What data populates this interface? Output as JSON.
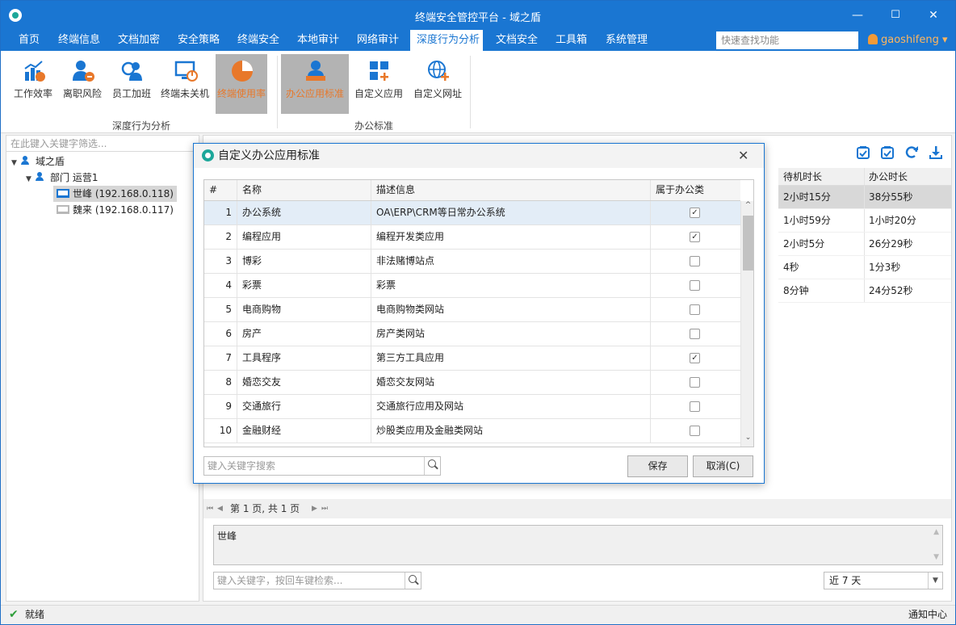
{
  "window": {
    "title": "终端安全管控平台 - 域之盾",
    "min": "—",
    "max": "☐",
    "close": "✕"
  },
  "menu": {
    "items": [
      {
        "label": "首页"
      },
      {
        "label": "终端信息"
      },
      {
        "label": "文档加密"
      },
      {
        "label": "安全策略"
      },
      {
        "label": "终端安全"
      },
      {
        "label": "本地审计"
      },
      {
        "label": "网络审计"
      },
      {
        "label": "深度行为分析",
        "active": true
      },
      {
        "label": "文档安全"
      },
      {
        "label": "工具箱"
      },
      {
        "label": "系统管理"
      }
    ],
    "search_placeholder": "快速查找功能",
    "user": "gaoshifeng",
    "user_caret": "▾"
  },
  "ribbon": {
    "groups": [
      {
        "label": "深度行为分析",
        "buttons": [
          "工作效率",
          "离职风险",
          "员工加班",
          "终端未关机",
          "终端使用率"
        ]
      },
      {
        "label": "办公标准",
        "buttons": [
          "办公应用标准",
          "自定义应用",
          "自定义网址"
        ]
      }
    ],
    "selected": [
      "终端使用率",
      "办公应用标准"
    ]
  },
  "tree": {
    "filter_placeholder": "在此键入关键字筛选...",
    "root": "域之盾",
    "dept": "部门 运营1",
    "terminals": [
      {
        "label": "世峰 (192.168.0.118)",
        "online": true,
        "selected": true
      },
      {
        "label": "魏来 (192.168.0.117)",
        "online": false,
        "selected": false
      }
    ]
  },
  "background_grid": {
    "columns": [
      "待机时长",
      "办公时长"
    ],
    "rows": [
      [
        "2小时15分",
        "38分55秒"
      ],
      [
        "1小时59分",
        "1小时20分"
      ],
      [
        "2小时5分",
        "26分29秒"
      ],
      [
        "4秒",
        "1分3秒"
      ],
      [
        "8分钟",
        "24分52秒"
      ]
    ]
  },
  "pager": {
    "text": "第 1 页, 共 1 页"
  },
  "detail": {
    "text": "世峰"
  },
  "bottom_search_placeholder": "键入关键字，按回车键检索...",
  "range_select": "近 7 天",
  "status": {
    "left": "就绪",
    "right": "通知中心"
  },
  "dialog": {
    "title": "自定义办公应用标准",
    "close": "✕",
    "columns": [
      "#",
      "名称",
      "描述信息",
      "属于办公类"
    ],
    "rows": [
      {
        "no": "1",
        "name": "办公系统",
        "desc": "OA\\ERP\\CRM等日常办公系统",
        "office": true
      },
      {
        "no": "2",
        "name": "编程应用",
        "desc": "编程开发类应用",
        "office": true
      },
      {
        "no": "3",
        "name": "博彩",
        "desc": "非法赌博站点",
        "office": false
      },
      {
        "no": "4",
        "name": "彩票",
        "desc": "彩票",
        "office": false
      },
      {
        "no": "5",
        "name": "电商购物",
        "desc": "电商购物类网站",
        "office": false
      },
      {
        "no": "6",
        "name": "房产",
        "desc": "房产类网站",
        "office": false
      },
      {
        "no": "7",
        "name": "工具程序",
        "desc": "第三方工具应用",
        "office": true
      },
      {
        "no": "8",
        "name": "婚恋交友",
        "desc": "婚恋交友网站",
        "office": false
      },
      {
        "no": "9",
        "name": "交通旅行",
        "desc": "交通旅行应用及网站",
        "office": false
      },
      {
        "no": "10",
        "name": "金融财经",
        "desc": "炒股类应用及金融类网站",
        "office": false
      }
    ],
    "search_placeholder": "键入关键字搜索",
    "save": "保存",
    "cancel": "取消(C)"
  },
  "colors": {
    "brand": "#1a76d2",
    "accent": "#e8782a",
    "teal": "#1da79a",
    "status_ok": "#2e9e3a"
  }
}
